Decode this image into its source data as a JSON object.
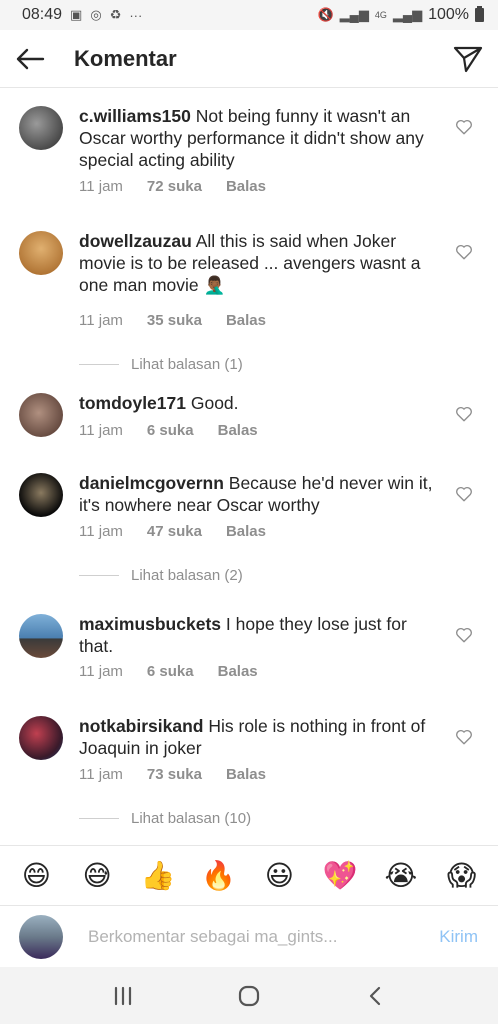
{
  "status_bar": {
    "time": "08:49",
    "more": "···",
    "network": "4G",
    "battery": "100%"
  },
  "header": {
    "title": "Komentar"
  },
  "comments": [
    {
      "username": "c.williams150",
      "text": "Not being funny it wasn't an Oscar worthy performance it didn't show any special acting ability",
      "time": "11 jam",
      "likes": "72 suka",
      "reply": "Balas",
      "avatar_color": "#3a3a3a"
    },
    {
      "username": "dowellzauzau",
      "text": "All this is said when Joker movie is to be released ... avengers wasnt a one man movie 🤦🏾‍♂️",
      "time": "11 jam",
      "likes": "35 suka",
      "reply": "Balas",
      "avatar_color": "#c98a3a",
      "view_replies": "Lihat balasan (1)"
    },
    {
      "username": "tomdoyle171",
      "text": "Good.",
      "time": "11 jam",
      "likes": "6 suka",
      "reply": "Balas",
      "avatar_color": "#7a5a4a"
    },
    {
      "username": "danielmcgovernn",
      "text": "Because he'd never win it, it's nowhere near Oscar worthy",
      "time": "11 jam",
      "likes": "47 suka",
      "reply": "Balas",
      "avatar_color": "#1a1a1a",
      "view_replies": "Lihat balasan (2)"
    },
    {
      "username": "maximusbuckets",
      "text": "I hope they lose just for that.",
      "time": "11 jam",
      "likes": "6 suka",
      "reply": "Balas",
      "avatar_color": "#4a7fb0"
    },
    {
      "username": "notkabirsikand",
      "text": "His role is nothing in front of Joaquin in joker",
      "time": "11 jam",
      "likes": "73 suka",
      "reply": "Balas",
      "avatar_color": "#5a2a3a",
      "view_replies": "Lihat balasan (10)"
    }
  ],
  "emoji_bar": [
    "😄",
    "😅",
    "👍",
    "🔥",
    "😃",
    "💖",
    "😭",
    "😱"
  ],
  "compose": {
    "placeholder": "Berkomentar sebagai ma_gints...",
    "post_label": "Kirim"
  },
  "colors": {
    "accent_disabled": "#8fc3f5",
    "secondary_text": "#8e8e8e"
  },
  "icons": {
    "back": "arrow-left-icon",
    "direct": "paper-plane-icon",
    "like": "heart-outline-icon",
    "nav_recent": "recent-apps-icon",
    "nav_home": "home-icon",
    "nav_back": "chevron-left-icon"
  }
}
